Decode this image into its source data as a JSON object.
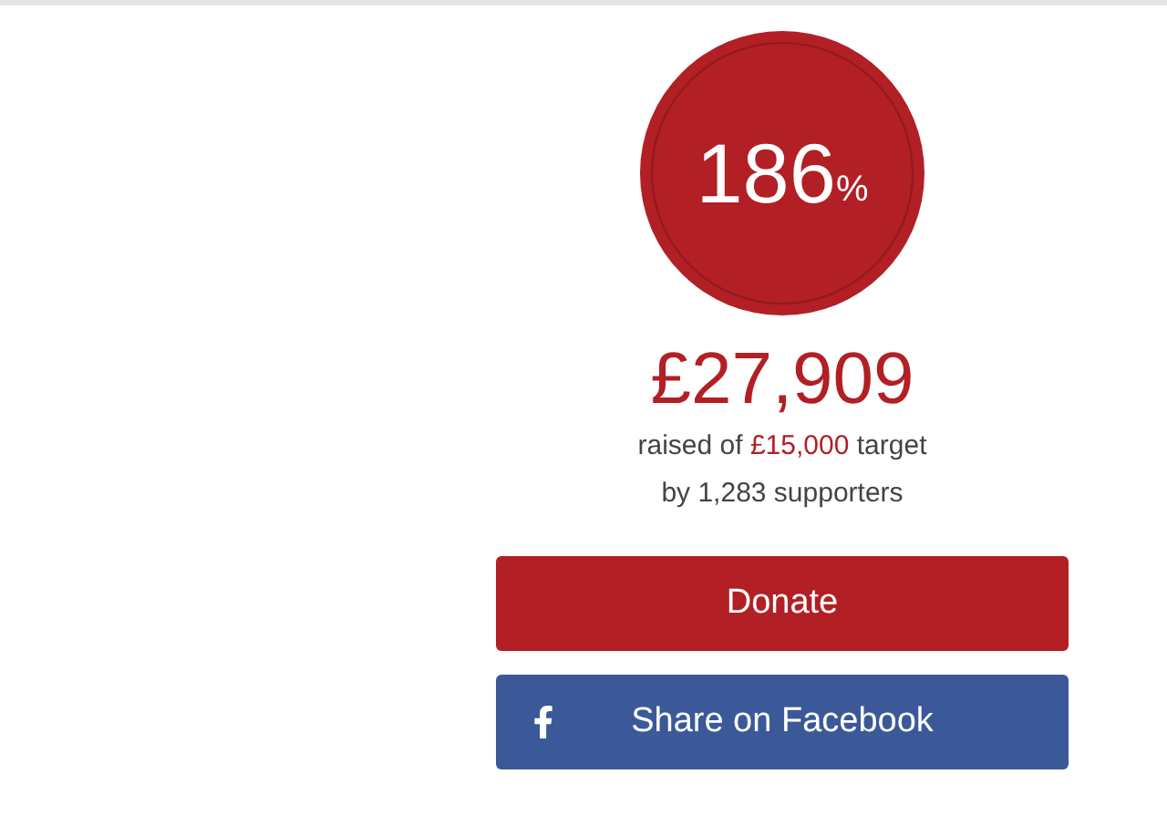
{
  "progress": {
    "percent": "186",
    "percent_sign": "%"
  },
  "raised": {
    "amount": "£27,909",
    "prefix": "raised of",
    "target": "£15,000",
    "suffix": "target"
  },
  "supporters": "by 1,283 supporters",
  "buttons": [
    {
      "kind": "donate",
      "label": "Donate"
    },
    {
      "kind": "facebook",
      "label": "Share on Facebook"
    }
  ]
}
